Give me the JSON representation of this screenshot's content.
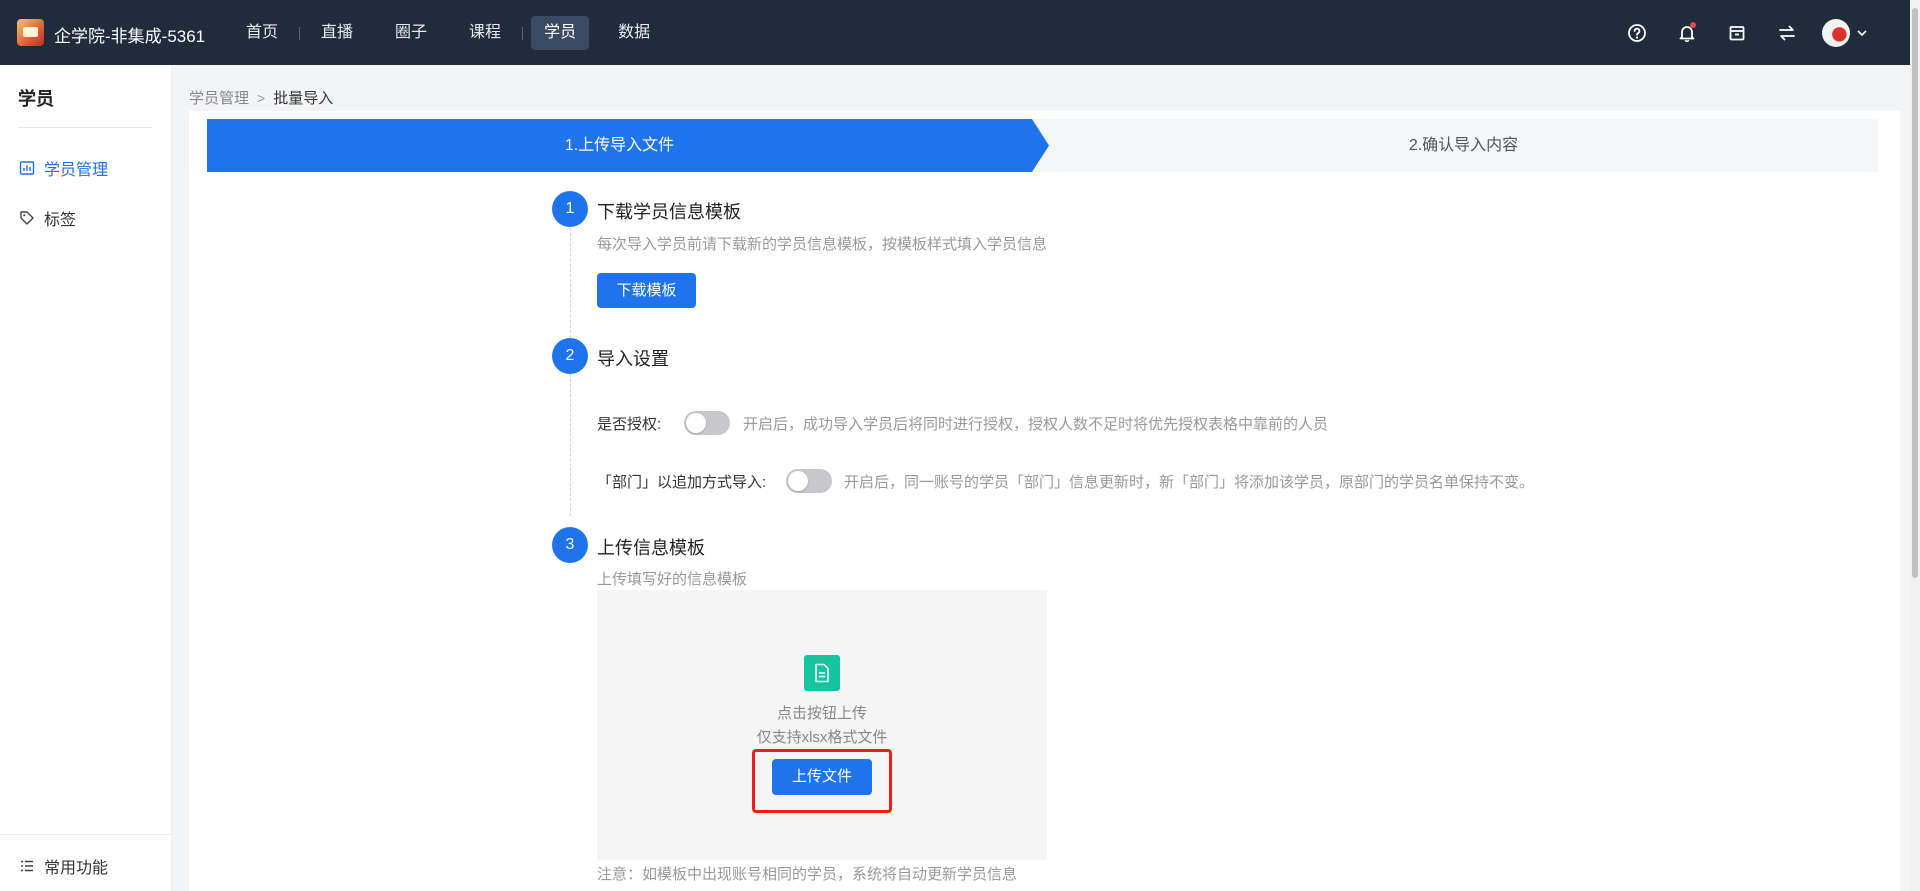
{
  "app": {
    "title": "企学院-非集成-5361"
  },
  "nav": {
    "items": [
      {
        "label": "首页"
      },
      {
        "label": "直播"
      },
      {
        "label": "圈子"
      },
      {
        "label": "课程"
      },
      {
        "label": "学员"
      },
      {
        "label": "数据"
      }
    ],
    "active": "学员"
  },
  "top_icons": [
    "help-icon",
    "bell-icon",
    "store-icon",
    "switch-icon",
    "avatar",
    "chevron-down-icon"
  ],
  "sidebar": {
    "title": "学员",
    "items": [
      {
        "label": "学员管理",
        "icon": "chart-icon"
      },
      {
        "label": "标签",
        "icon": "tag-icon"
      }
    ],
    "footer": {
      "label": "常用功能",
      "icon": "list-icon"
    }
  },
  "breadcrumb": {
    "parent": "学员管理",
    "current": "批量导入"
  },
  "steps": {
    "step1": "1.上传导入文件",
    "step2": "2.确认导入内容"
  },
  "section1": {
    "num": "1",
    "title": "下载学员信息模板",
    "desc": "每次导入学员前请下载新的学员信息模板，按模板样式填入学员信息",
    "button": "下载模板"
  },
  "section2": {
    "num": "2",
    "title": "导入设置",
    "auth_label": "是否授权:",
    "auth_hint": "开启后，成功导入学员后将同时进行授权，授权人数不足时将优先授权表格中靠前的人员",
    "auth_on": false,
    "dept_label": "「部门」以追加方式导入:",
    "dept_hint": "开启后，同一账号的学员「部门」信息更新时，新「部门」将添加该学员，原部门的学员名单保持不变。",
    "dept_on": false
  },
  "section3": {
    "num": "3",
    "title": "上传信息模板",
    "desc": "上传填写好的信息模板",
    "upload_text1": "点击按钮上传",
    "upload_text2": "仅支持xlsx格式文件",
    "button": "上传文件",
    "note": "注意：如模板中出现账号相同的学员，系统将自动更新学员信息"
  },
  "colors": {
    "primary": "#1f74ee",
    "topbar": "#202b3b",
    "highlight": "#ee1d1d",
    "file_icon": "#16c4a0"
  }
}
